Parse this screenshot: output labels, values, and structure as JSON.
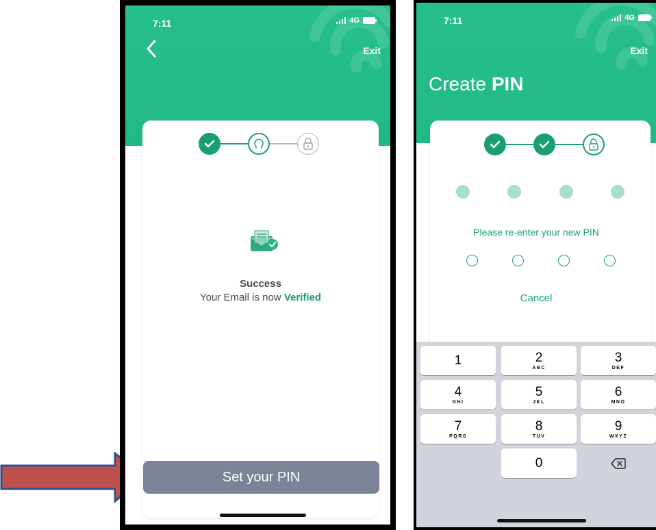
{
  "left_screen": {
    "status": {
      "time": "7:11",
      "network": "4G"
    },
    "header": {
      "exit_label": "Exit"
    },
    "success": {
      "title": "Success",
      "message_prefix": "Your Email is now",
      "message_highlight": "Verified"
    },
    "primary_button": {
      "label": "Set your PIN"
    }
  },
  "right_screen": {
    "status": {
      "time": "7:11",
      "network": "4G"
    },
    "header": {
      "exit_label": "Exit",
      "title_prefix": "Create",
      "title_bold": "PIN"
    },
    "pin": {
      "prompt": "Please re-enter your new PIN",
      "cancel_label": "Cancel",
      "entered_count": 4,
      "length": 4
    },
    "keypad": {
      "keys": [
        {
          "digit": "1",
          "letters": ""
        },
        {
          "digit": "2",
          "letters": "ABC"
        },
        {
          "digit": "3",
          "letters": "DEF"
        },
        {
          "digit": "4",
          "letters": "GHI"
        },
        {
          "digit": "5",
          "letters": "JKL"
        },
        {
          "digit": "6",
          "letters": "MNO"
        },
        {
          "digit": "7",
          "letters": "PQRS"
        },
        {
          "digit": "8",
          "letters": "TUV"
        },
        {
          "digit": "9",
          "letters": "WXYZ"
        },
        {
          "digit": "0",
          "letters": ""
        }
      ],
      "delete_icon": "backspace-icon"
    }
  },
  "colors": {
    "brand_green": "#20b887",
    "accent_green": "#1a9e6e",
    "pin_dot_filled": "#a7dfc8",
    "button_grey": "#7c8399",
    "arrow_red": "#c0504d",
    "arrow_blue": "#2f528f"
  }
}
